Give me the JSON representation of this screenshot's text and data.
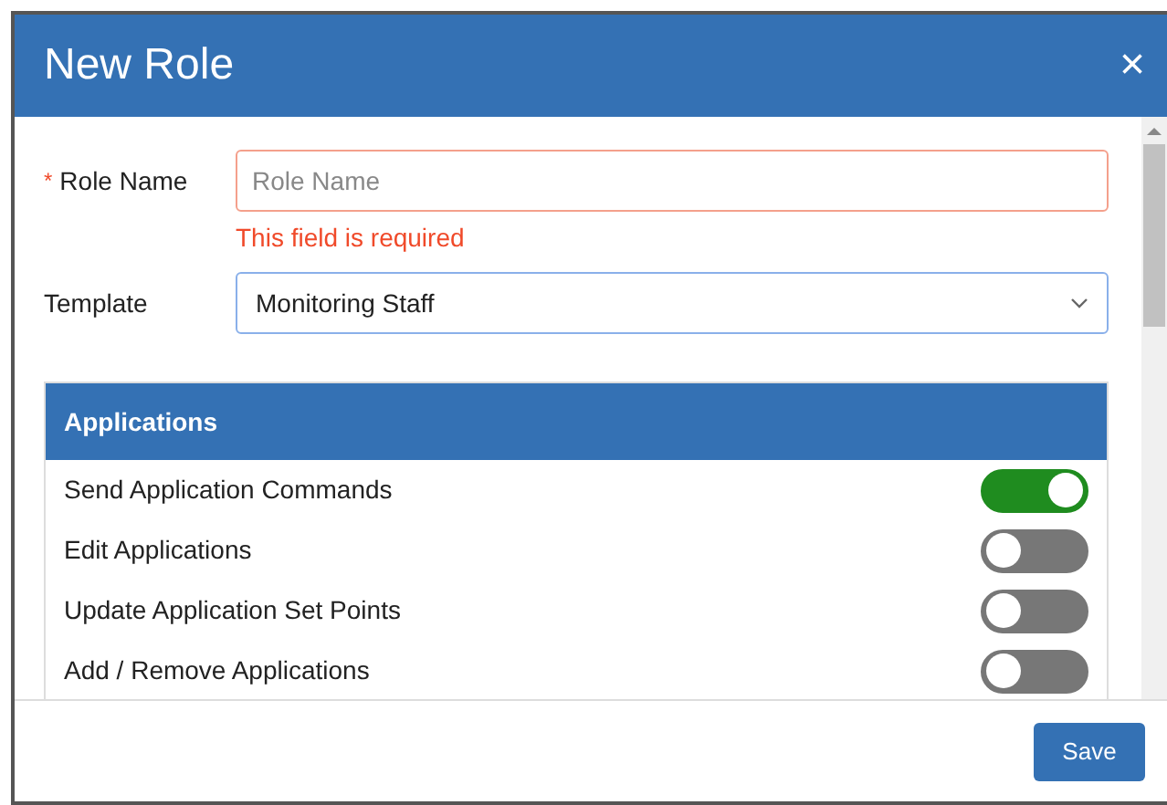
{
  "dialog": {
    "title": "New Role",
    "close_symbol": "×"
  },
  "form": {
    "role_name": {
      "required_mark": "*",
      "label": "Role Name",
      "placeholder": "Role Name",
      "error": "This field is required"
    },
    "template": {
      "label": "Template",
      "value": "Monitoring Staff"
    }
  },
  "applications": {
    "title": "Applications",
    "permissions": [
      {
        "label": "Send Application Commands",
        "on": true
      },
      {
        "label": "Edit Applications",
        "on": false
      },
      {
        "label": "Update Application Set Points",
        "on": false
      },
      {
        "label": "Add / Remove Applications",
        "on": false
      }
    ]
  },
  "footer": {
    "save": "Save"
  }
}
